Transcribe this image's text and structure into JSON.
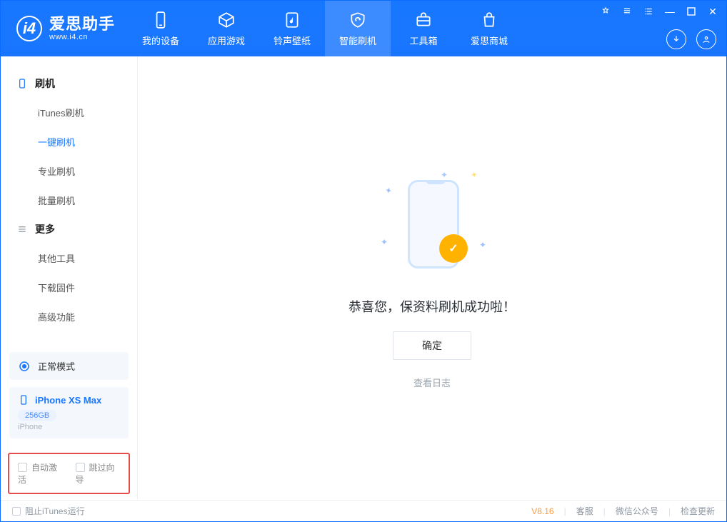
{
  "colors": {
    "primary": "#1777ff",
    "accent": "#ffb300",
    "danger": "#e74a4a"
  },
  "header": {
    "app_title": "爱思助手",
    "app_sub": "www.i4.cn",
    "tabs": [
      {
        "label": "我的设备"
      },
      {
        "label": "应用游戏"
      },
      {
        "label": "铃声壁纸"
      },
      {
        "label": "智能刷机"
      },
      {
        "label": "工具箱"
      },
      {
        "label": "爱思商城"
      }
    ],
    "active_tab": 3
  },
  "sidebar": {
    "groups": [
      {
        "title": "刷机",
        "items": [
          "iTunes刷机",
          "一键刷机",
          "专业刷机",
          "批量刷机"
        ],
        "active": 1
      },
      {
        "title": "更多",
        "items": [
          "其他工具",
          "下载固件",
          "高级功能"
        ],
        "active": -1
      }
    ],
    "mode": "正常模式",
    "device": {
      "name": "iPhone XS Max",
      "storage": "256GB",
      "type": "iPhone"
    },
    "options": {
      "auto_activate": "自动激活",
      "skip_guide": "跳过向导"
    }
  },
  "content": {
    "message": "恭喜您，保资料刷机成功啦！",
    "ok": "确定",
    "view_log": "查看日志"
  },
  "footer": {
    "block_itunes": "阻止iTunes运行",
    "version": "V8.16",
    "links": [
      "客服",
      "微信公众号",
      "检查更新"
    ]
  }
}
